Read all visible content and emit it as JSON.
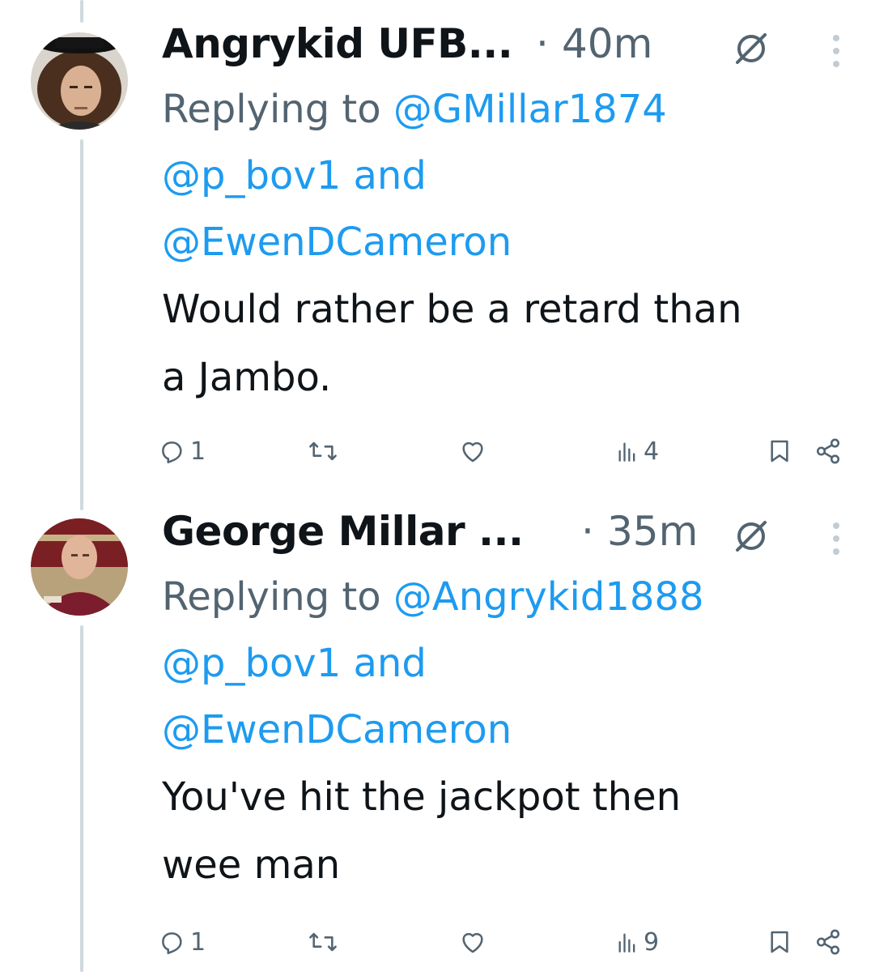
{
  "tweets": [
    {
      "name": "Angrykid UFB...",
      "dot": "·",
      "time": "40m",
      "reply_prefix": "Replying to",
      "reply_to_1": "@GMillar1874",
      "reply_to_2": "@p_bov1",
      "reply_and": "and",
      "reply_to_3": "@EwenDCameron",
      "text_line_1": "Would rather be a retard than",
      "text_line_2": "a Jambo.",
      "replies": "1",
      "views": "4"
    },
    {
      "name": "George Millar ...",
      "dot": "·",
      "time": "35m",
      "reply_prefix": "Replying to",
      "reply_to_1": "@Angrykid1888",
      "reply_to_2": "@p_bov1",
      "reply_and": "and",
      "reply_to_3": "@EwenDCameron",
      "text_line_1": "You've hit the jackpot then",
      "text_line_2": "wee man",
      "replies": "1",
      "views": "9"
    }
  ],
  "colors": {
    "text": "#0f1419",
    "secondary": "#536471",
    "link": "#1d9bf0",
    "thread_line": "#cfd9de"
  },
  "icons": [
    "grok-icon",
    "more-icon",
    "reply-icon",
    "retweet-icon",
    "like-icon",
    "views-icon",
    "bookmark-icon",
    "share-icon"
  ]
}
